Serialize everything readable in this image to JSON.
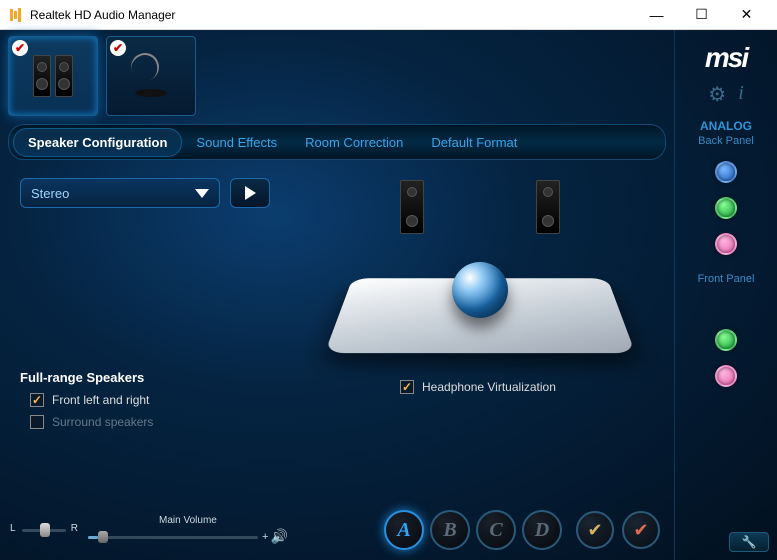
{
  "window": {
    "title": "Realtek HD Audio Manager"
  },
  "brand": {
    "logo": "msi"
  },
  "devices": {
    "speakers_checked": true,
    "mic_checked": true
  },
  "tabs": {
    "items": [
      {
        "label": "Speaker Configuration",
        "active": true
      },
      {
        "label": "Sound Effects",
        "active": false
      },
      {
        "label": "Room Correction",
        "active": false
      },
      {
        "label": "Default Format",
        "active": false
      }
    ]
  },
  "config": {
    "mode": "Stereo"
  },
  "full_range": {
    "title": "Full-range Speakers",
    "front": {
      "label": "Front left and right",
      "checked": true
    },
    "surround": {
      "label": "Surround speakers",
      "checked": false
    }
  },
  "headphone_virt": {
    "label": "Headphone Virtualization",
    "checked": true
  },
  "balance": {
    "left_label": "L",
    "right_label": "R"
  },
  "volume": {
    "label": "Main Volume",
    "plus": "+"
  },
  "presets": {
    "items": [
      {
        "label": "A",
        "active": true
      },
      {
        "label": "B",
        "active": false
      },
      {
        "label": "C",
        "active": false
      },
      {
        "label": "D",
        "active": false
      }
    ]
  },
  "side": {
    "analog_label": "ANALOG",
    "back_panel_label": "Back Panel",
    "front_panel_label": "Front Panel"
  }
}
